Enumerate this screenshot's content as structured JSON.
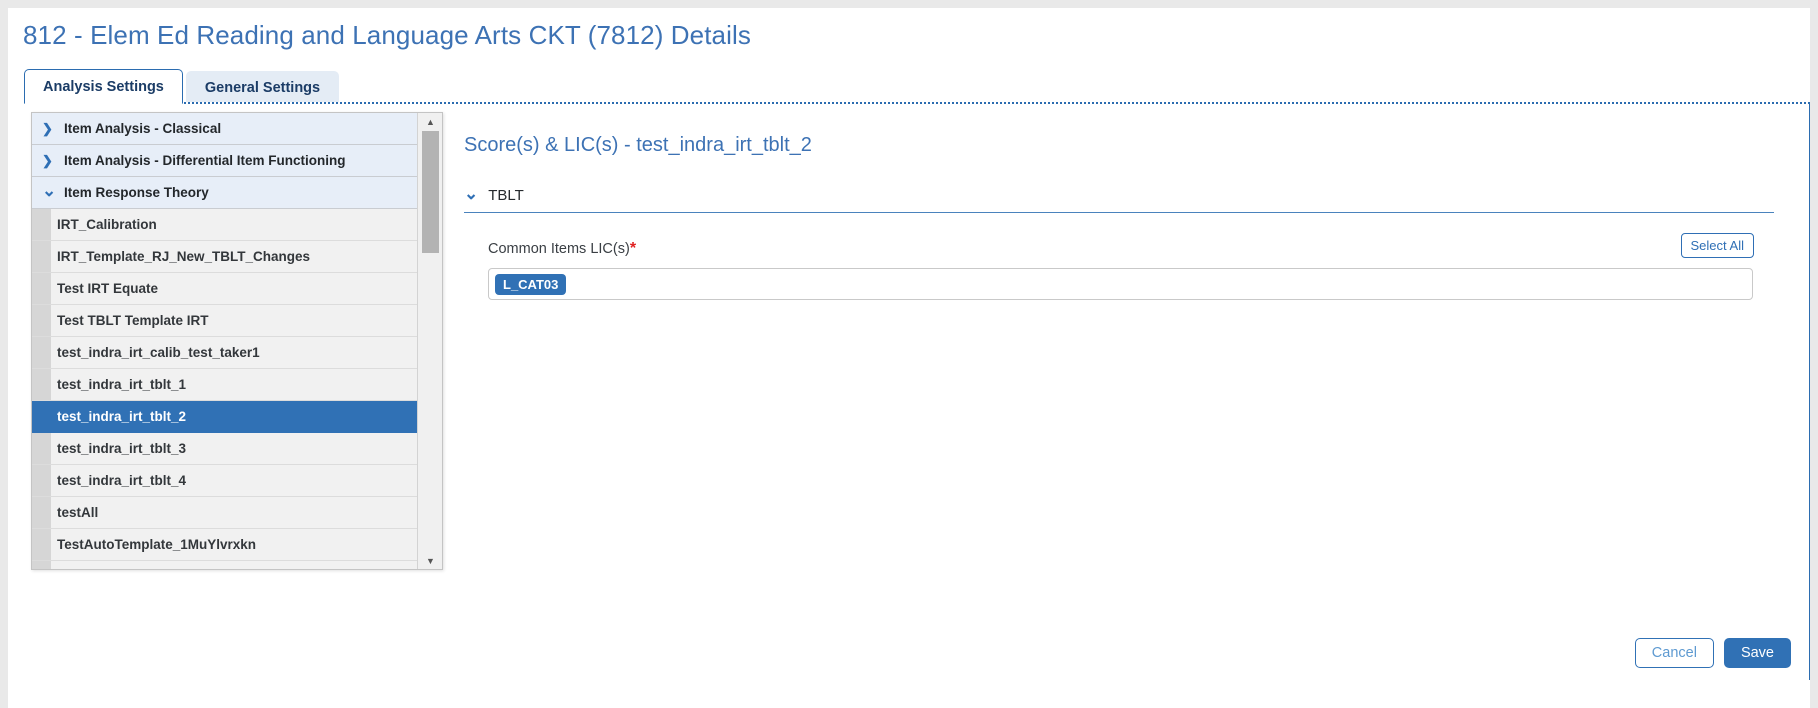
{
  "page": {
    "title": "812 - Elem Ed Reading and Language Arts CKT (7812) Details"
  },
  "tabs": [
    {
      "label": "Analysis Settings",
      "active": true
    },
    {
      "label": "General Settings",
      "active": false
    }
  ],
  "sidebar": {
    "groups": [
      {
        "type": "header",
        "label": "Item Analysis - Classical",
        "expanded": false,
        "icon": "chevron-right-icon"
      },
      {
        "type": "header",
        "label": "Item Analysis - Differential Item Functioning",
        "expanded": false,
        "icon": "chevron-right-icon"
      },
      {
        "type": "header",
        "label": "Item Response Theory",
        "expanded": true,
        "icon": "chevron-down-icon"
      }
    ],
    "items": [
      {
        "label": "IRT_Calibration",
        "selected": false
      },
      {
        "label": "IRT_Template_RJ_New_TBLT_Changes",
        "selected": false
      },
      {
        "label": "Test IRT Equate",
        "selected": false
      },
      {
        "label": "Test TBLT Template IRT",
        "selected": false
      },
      {
        "label": "test_indra_irt_calib_test_taker1",
        "selected": false
      },
      {
        "label": "test_indra_irt_tblt_1",
        "selected": false
      },
      {
        "label": "test_indra_irt_tblt_2",
        "selected": true
      },
      {
        "label": "test_indra_irt_tblt_3",
        "selected": false
      },
      {
        "label": "test_indra_irt_tblt_4",
        "selected": false
      },
      {
        "label": "testAll",
        "selected": false
      },
      {
        "label": "TestAutoTemplate_1MuYlvrxkn",
        "selected": false
      }
    ],
    "scrollbar": {
      "up_arrow": "▲",
      "down_arrow": "▼"
    }
  },
  "detail": {
    "title": "Score(s) & LIC(s) - test_indra_irt_tblt_2",
    "section": {
      "label": "TBLT",
      "expanded": true,
      "icon": "chevron-down-icon"
    },
    "field": {
      "label": "Common Items LIC(s)",
      "required_marker": "*",
      "select_all_label": "Select All",
      "chips": [
        "L_CAT03"
      ]
    }
  },
  "footer": {
    "cancel_label": "Cancel",
    "save_label": "Save"
  },
  "icons": {
    "chevron_right": "❯",
    "chevron_down": "⌄"
  },
  "colors": {
    "accent_blue": "#3071b5",
    "title_blue": "#3d72b4",
    "header_bg": "#e7eef8",
    "row_bg": "#f1f1f1",
    "required_red": "#e02020"
  }
}
